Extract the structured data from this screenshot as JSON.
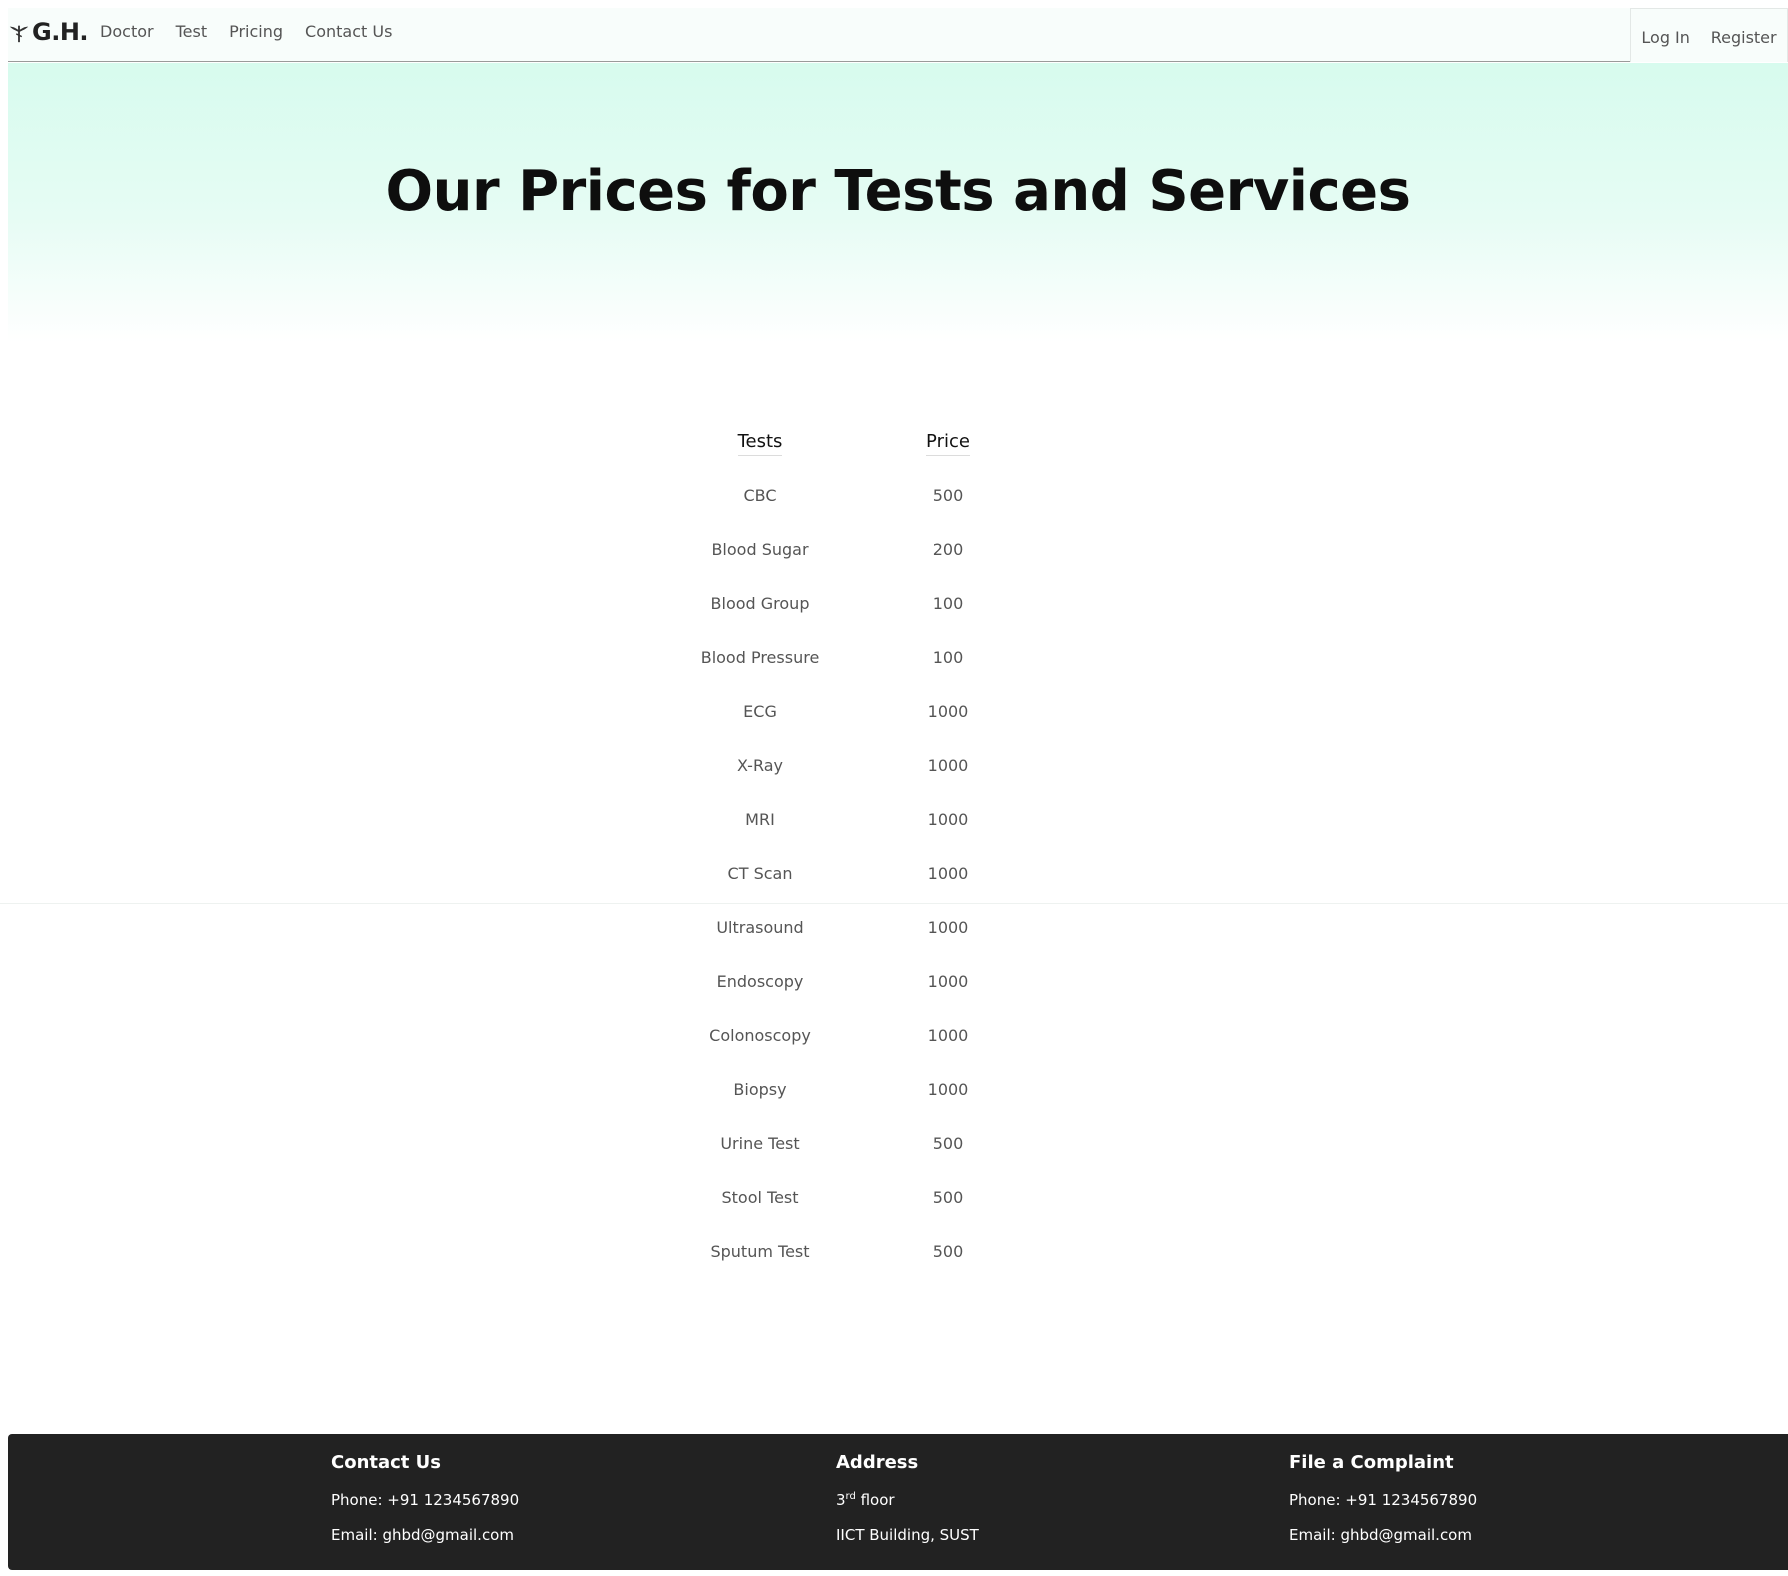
{
  "nav": {
    "brand": "G.H.",
    "links": [
      {
        "label": "Doctor"
      },
      {
        "label": "Test"
      },
      {
        "label": "Pricing"
      },
      {
        "label": "Contact Us"
      }
    ],
    "login": "Log In",
    "register": "Register"
  },
  "hero": {
    "title": "Our Prices for Tests and Services"
  },
  "table": {
    "headers": {
      "test": "Tests",
      "price": "Price"
    },
    "rows": [
      {
        "test": "CBC",
        "price": "500"
      },
      {
        "test": "Blood Sugar",
        "price": "200"
      },
      {
        "test": "Blood Group",
        "price": "100"
      },
      {
        "test": "Blood Pressure",
        "price": "100"
      },
      {
        "test": "ECG",
        "price": "1000"
      },
      {
        "test": "X-Ray",
        "price": "1000"
      },
      {
        "test": "MRI",
        "price": "1000"
      },
      {
        "test": "CT Scan",
        "price": "1000"
      },
      {
        "test": "Ultrasound",
        "price": "1000"
      },
      {
        "test": "Endoscopy",
        "price": "1000"
      },
      {
        "test": "Colonoscopy",
        "price": "1000"
      },
      {
        "test": "Biopsy",
        "price": "1000"
      },
      {
        "test": "Urine Test",
        "price": "500"
      },
      {
        "test": "Stool Test",
        "price": "500"
      },
      {
        "test": "Sputum Test",
        "price": "500"
      }
    ]
  },
  "footer": {
    "contact": {
      "title": "Contact Us",
      "phone": "Phone: +91 1234567890",
      "email": "Email: ghbd@gmail.com"
    },
    "address": {
      "title": "Address",
      "line1_num": "3",
      "line1_sup": "rd",
      "line1_rest": " floor",
      "line2": "IICT Building, SUST"
    },
    "complaint": {
      "title": "File a Complaint",
      "phone": "Phone: +91 1234567890",
      "email": "Email: ghbd@gmail.com"
    }
  },
  "colors": {
    "hero_bg_top": "#d7fbee",
    "footer_bg": "#222222",
    "navbar_bg": "#f8fdfb"
  }
}
